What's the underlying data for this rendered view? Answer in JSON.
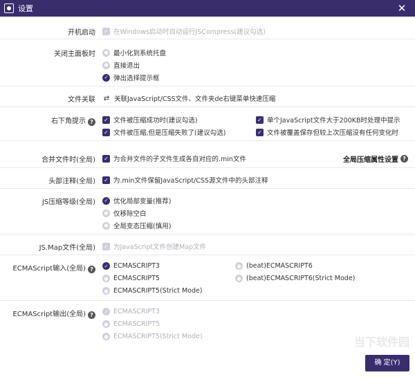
{
  "window": {
    "title": "设置",
    "close_label": "✕"
  },
  "rows": {
    "startup": {
      "label": "开机启动",
      "option": "在Windows启动时自动运行JSCompress(建议勾选)"
    },
    "close_panel": {
      "label": "关闭主面板时",
      "options": [
        "最小化到系统托盘",
        "直接退出",
        "弹出选择提示框"
      ]
    },
    "file_assoc": {
      "label": "文件关联",
      "option": "关联JavaScript/CSS文件、文件夹de右键菜单快速压缩"
    },
    "corner_tip": {
      "label": "右下角提示",
      "options": [
        "文件被压缩成功时(建议勾选)",
        "单个JavaScript文件大于200KB时处理中提示",
        "文件被压缩,但是压缩失败了(建议勾选)",
        "文件被覆盖保存但较上次压缩没有任何变化时"
      ]
    },
    "merge": {
      "label": "合并文件时(全局)",
      "option": "为合并文件的子文件生成各自对应的.min文件",
      "link": "全局压缩属性设置"
    },
    "header_comment": {
      "label": "头部注释(全局)",
      "option": "为.min文件保留JavaScript/CSS源文件中的头部注释"
    },
    "js_level": {
      "label": "JS压缩等级(全局)",
      "options": [
        "优化局部变量(推荐)",
        "仅移除空白",
        "全局变态压缩(慎用)"
      ]
    },
    "js_map": {
      "label": "JS.Map文件(全局)",
      "option": "为JavaScript文件创建Map文件"
    },
    "ecma_in": {
      "label": "ECMAScript输入(全局)",
      "options": [
        "ECMASCRIPT3",
        "(beat)ECMASCRIPT6",
        "ECMASCRIPT5",
        "(beat)ECMASCRIPT6(Strict Mode)",
        "ECMASCRIPT5(Strict Mode)"
      ]
    },
    "ecma_out": {
      "label": "ECMAScript输出(全局)",
      "options": [
        "ECMASCRIPT3",
        "ECMASCRIPT5",
        "ECMASCRIPT5(Strict Mode)"
      ]
    }
  },
  "footer": {
    "ok_label": "确 定(Y)"
  },
  "watermark": "当下软件园",
  "colors": {
    "accent": "#3a2d6e",
    "disabled": "#d0cfdc"
  }
}
